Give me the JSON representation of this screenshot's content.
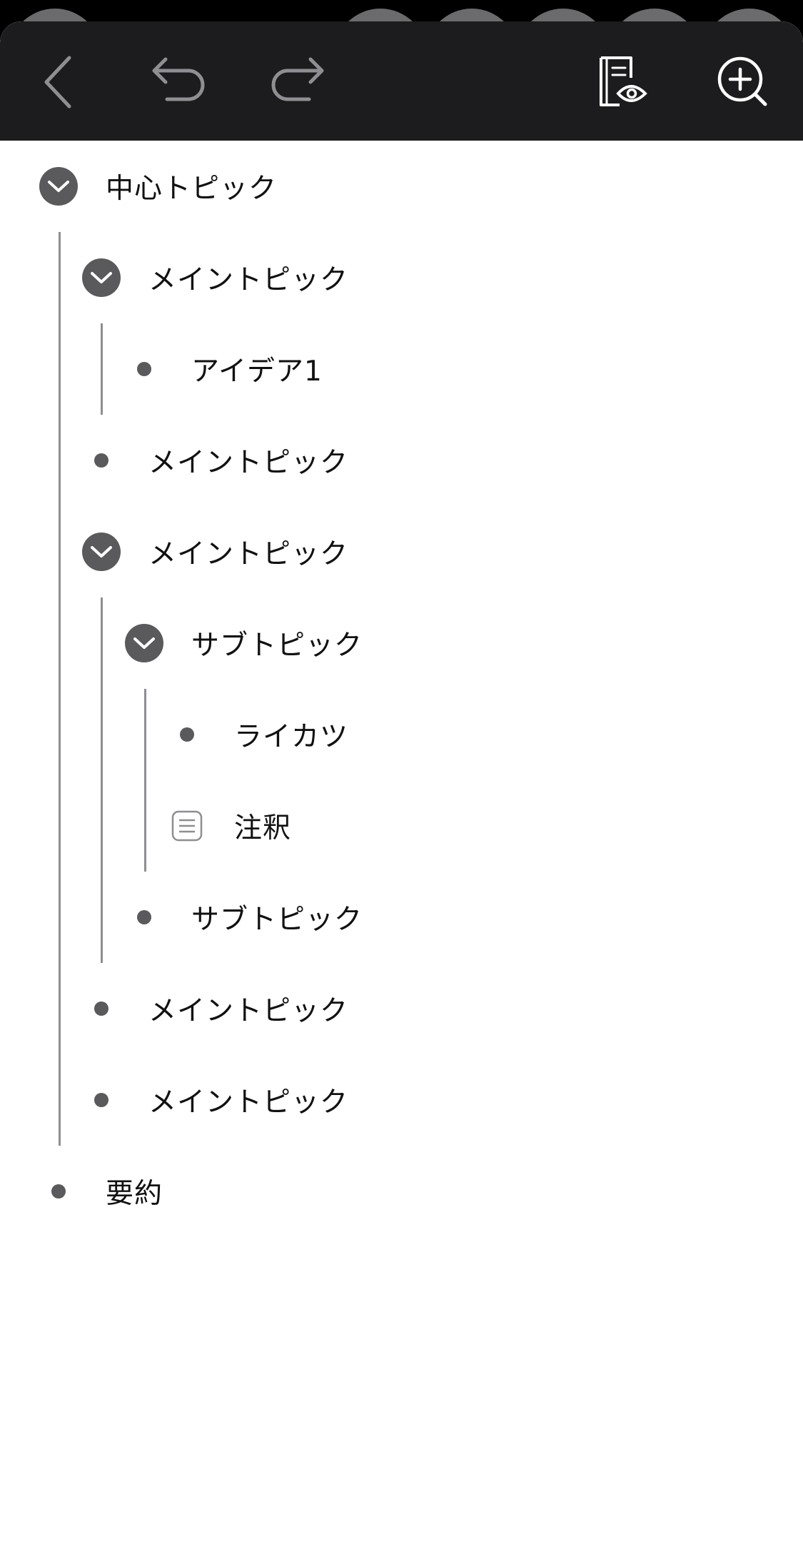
{
  "toolbar": {
    "buttons": [
      {
        "name": "back",
        "icon": "chevron-left-icon"
      },
      {
        "name": "undo",
        "icon": "undo-arrow-icon"
      },
      {
        "name": "redo",
        "icon": "redo-arrow-icon"
      },
      {
        "name": "preview",
        "icon": "document-eye-icon"
      },
      {
        "name": "add-topic",
        "icon": "plus-magnifier-icon"
      }
    ],
    "background": "#1c1c1e",
    "icon_color": "#ffffff",
    "disabled_icon_color": "#8e8e93"
  },
  "outline": {
    "nodes": [
      {
        "label": "中心トピック",
        "level": 0,
        "marker": "toggle",
        "expanded": true
      },
      {
        "label": "メイントピック",
        "level": 1,
        "marker": "toggle",
        "expanded": true
      },
      {
        "label": "アイデア1",
        "level": 2,
        "marker": "bullet"
      },
      {
        "label": "メイントピック",
        "level": 1,
        "marker": "bullet"
      },
      {
        "label": "メイントピック",
        "level": 1,
        "marker": "toggle",
        "expanded": true
      },
      {
        "label": "サブトピック",
        "level": 2,
        "marker": "toggle",
        "expanded": true
      },
      {
        "label": "ライカツ",
        "level": 3,
        "marker": "bullet"
      },
      {
        "label": "注釈",
        "level": 3,
        "marker": "note"
      },
      {
        "label": "サブトピック",
        "level": 2,
        "marker": "bullet"
      },
      {
        "label": "メイントピック",
        "level": 1,
        "marker": "bullet"
      },
      {
        "label": "メイントピック",
        "level": 1,
        "marker": "bullet"
      },
      {
        "label": "要約",
        "level": 0,
        "marker": "bullet"
      }
    ],
    "marker_color": "#5a5a5c",
    "guide_line_color": "#8e8e93",
    "text_color": "#111111"
  }
}
